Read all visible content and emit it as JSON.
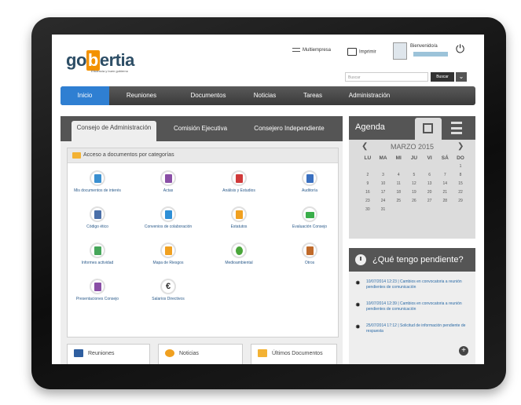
{
  "header": {
    "logo_prefix": "go",
    "logo_highlight": "b",
    "logo_suffix": "ertia",
    "tagline": "Eficiencia y buen gobierno",
    "multiempresa": "Multiempresa",
    "imprimir": "Imprimir",
    "welcome": "Bienvenido/a",
    "search_placeholder": "Buscar",
    "search_button": "Buscar"
  },
  "nav": [
    "Inicio",
    "Reuniones",
    "Documentos",
    "Noticias",
    "Tareas",
    "Administración"
  ],
  "tabs": [
    "Consejo de Administración",
    "Comisión Ejecutiva",
    "Consejero Independiente"
  ],
  "docs_box": {
    "title": "Acceso a documentos por categorías",
    "items": [
      {
        "label": "Mis documentos de interés",
        "color": "#3a8fd0"
      },
      {
        "label": "Actas",
        "color": "#8a4fa6"
      },
      {
        "label": "Análisis y Estudios",
        "color": "#d03a3a"
      },
      {
        "label": "Auditoría",
        "color": "#3a70c0"
      },
      {
        "label": "Código ético",
        "color": "#4a6fa8"
      },
      {
        "label": "Convenios de colaboración",
        "color": "#2e8fd6"
      },
      {
        "label": "Estatutos",
        "color": "#f0a020"
      },
      {
        "label": "Evaluación Consejo",
        "color": "#3aae4a"
      },
      {
        "label": "Informes actividad",
        "color": "#46a65a"
      },
      {
        "label": "Mapa de Riesgos",
        "color": "#f0a020"
      },
      {
        "label": "Medioambiental",
        "color": "#4aa63a"
      },
      {
        "label": "Otros",
        "color": "#c06a2a"
      },
      {
        "label": "Presentaciones Consejo",
        "color": "#8a4fa6"
      },
      {
        "label": "Salarios Directivos",
        "color": "#333333"
      }
    ]
  },
  "bottom_tabs": [
    "Reuniones",
    "Noticias",
    "Últimos Documentos"
  ],
  "agenda": {
    "title": "Agenda",
    "month": "MARZO 2015",
    "weekdays": [
      "LU",
      "MA",
      "MI",
      "JU",
      "VI",
      "SÁ",
      "DO"
    ],
    "weeks": [
      [
        "",
        "",
        "",
        "",
        "",
        "",
        "1"
      ],
      [
        "2",
        "3",
        "4",
        "5",
        "6",
        "7",
        "8"
      ],
      [
        "9",
        "10",
        "11",
        "12",
        "13",
        "14",
        "15"
      ],
      [
        "16",
        "17",
        "18",
        "19",
        "20",
        "21",
        "22"
      ],
      [
        "23",
        "24",
        "25",
        "26",
        "27",
        "28",
        "29"
      ],
      [
        "30",
        "31",
        "",
        "",
        "",
        "",
        ""
      ]
    ]
  },
  "pending": {
    "title": "¿Qué tengo pendiente?",
    "items": [
      "10/07/2014 12:23 | Cambios en convocatoria a reunión pendientes de comunicación",
      "10/07/2014 12:39 | Cambios en convocatoria a reunión pendientes de comunicación",
      "25/07/2014 17:12 | Solicitud de información pendiente de respuesta"
    ]
  }
}
